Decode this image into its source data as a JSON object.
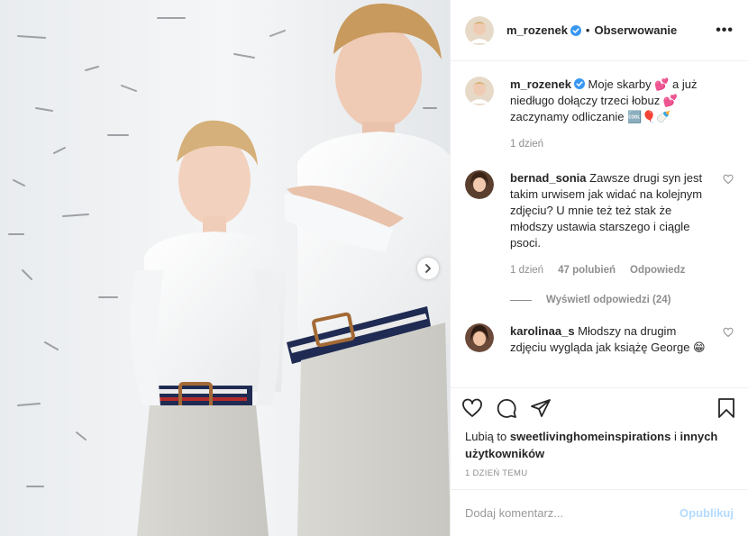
{
  "post": {
    "author": "m_rozenek",
    "follow_label": "Obserwowanie",
    "dot": "•",
    "more_label": "•••",
    "caption_author": "m_rozenek",
    "caption_text": "Moje skarby 💕 a już niedługo dołączy trzeci łobuz 💕 zaczynamy odliczanie 🆒🎈🍼",
    "caption_time": "1 dzień"
  },
  "comments": [
    {
      "author": "bernad_sonia",
      "text": "Zawsze drugi syn jest takim urwisem jak widać na kolejnym zdjęciu? U mnie też też stak że młodszy ustawia starszego i ciągle psoci.",
      "time": "1 dzień",
      "likes": "47 polubień",
      "reply_label": "Odpowiedz",
      "view_replies": "Wyświetl odpowiedzi (24)"
    },
    {
      "author": "karolinaa_s",
      "text": "Młodszy na drugim zdjęciu wygląda jak książę George 😁"
    }
  ],
  "likes_line": {
    "prefix": "Lubią to",
    "user": "sweetlivinghomeinspirations",
    "conj": "i",
    "others": "innych użytkowników"
  },
  "posted_ago": "1 DZIEŃ TEMU",
  "add_comment": {
    "placeholder": "Dodaj komentarz...",
    "publish_label": "Opublikuj"
  },
  "colors": {
    "verified": "#3897f0",
    "muted": "#8e8e8e",
    "publish": "#b3dbff"
  }
}
